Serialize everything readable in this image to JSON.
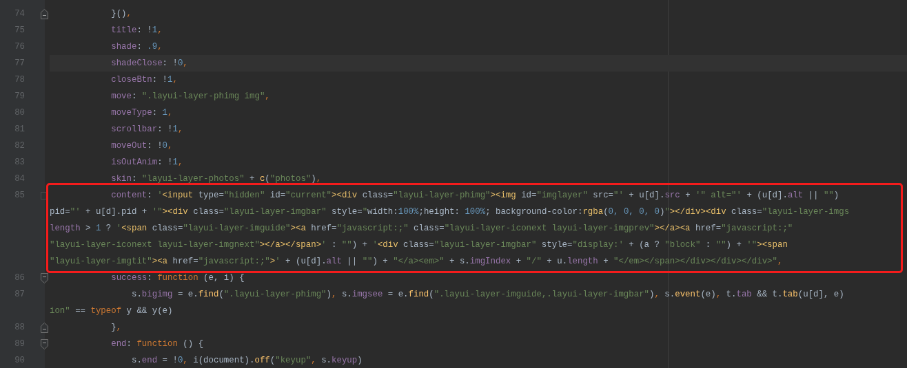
{
  "rows": [
    {
      "number": "74",
      "kind": "fold_end",
      "current": false,
      "tokens": [
        {
          "text": "            }()",
          "kind": "plain"
        },
        {
          "text": ",",
          "kind": "keyword"
        }
      ]
    },
    {
      "number": "75",
      "kind": "line",
      "current": false,
      "tokens": [
        {
          "text": "            title",
          "kind": "prop"
        },
        {
          "text": ": !",
          "kind": "plain"
        },
        {
          "text": "1",
          "kind": "num"
        },
        {
          "text": ",",
          "kind": "keyword"
        }
      ]
    },
    {
      "number": "76",
      "kind": "line",
      "current": false,
      "tokens": [
        {
          "text": "            shade",
          "kind": "prop"
        },
        {
          "text": ": ",
          "kind": "plain"
        },
        {
          "text": ".9",
          "kind": "num"
        },
        {
          "text": ",",
          "kind": "keyword"
        }
      ]
    },
    {
      "number": "77",
      "kind": "line",
      "current": true,
      "tokens": [
        {
          "text": "            shadeClose",
          "kind": "prop"
        },
        {
          "text": ": !",
          "kind": "plain"
        },
        {
          "text": "0",
          "kind": "num"
        },
        {
          "text": ",",
          "kind": "keyword"
        }
      ]
    },
    {
      "number": "78",
      "kind": "line",
      "current": false,
      "tokens": [
        {
          "text": "            closeBtn",
          "kind": "prop"
        },
        {
          "text": ": !",
          "kind": "plain"
        },
        {
          "text": "1",
          "kind": "num"
        },
        {
          "text": ",",
          "kind": "keyword"
        }
      ]
    },
    {
      "number": "79",
      "kind": "line",
      "current": false,
      "tokens": [
        {
          "text": "            move",
          "kind": "prop"
        },
        {
          "text": ": ",
          "kind": "plain"
        },
        {
          "text": "\".layui-layer-phimg img\"",
          "kind": "str"
        },
        {
          "text": ",",
          "kind": "keyword"
        }
      ]
    },
    {
      "number": "80",
      "kind": "line",
      "current": false,
      "tokens": [
        {
          "text": "            moveType",
          "kind": "prop"
        },
        {
          "text": ": ",
          "kind": "plain"
        },
        {
          "text": "1",
          "kind": "num"
        },
        {
          "text": ",",
          "kind": "keyword"
        }
      ]
    },
    {
      "number": "81",
      "kind": "line",
      "current": false,
      "tokens": [
        {
          "text": "            scrollbar",
          "kind": "prop"
        },
        {
          "text": ": !",
          "kind": "plain"
        },
        {
          "text": "1",
          "kind": "num"
        },
        {
          "text": ",",
          "kind": "keyword"
        }
      ]
    },
    {
      "number": "82",
      "kind": "line",
      "current": false,
      "tokens": [
        {
          "text": "            moveOut",
          "kind": "prop"
        },
        {
          "text": ": !",
          "kind": "plain"
        },
        {
          "text": "0",
          "kind": "num"
        },
        {
          "text": ",",
          "kind": "keyword"
        }
      ]
    },
    {
      "number": "83",
      "kind": "line",
      "current": false,
      "tokens": [
        {
          "text": "            isOutAnim",
          "kind": "prop"
        },
        {
          "text": ": !",
          "kind": "plain"
        },
        {
          "text": "1",
          "kind": "num"
        },
        {
          "text": ",",
          "kind": "keyword"
        }
      ]
    },
    {
      "number": "84",
      "kind": "line",
      "current": false,
      "tokens": [
        {
          "text": "            skin",
          "kind": "prop"
        },
        {
          "text": ": ",
          "kind": "plain"
        },
        {
          "text": "\"layui-layer-photos\"",
          "kind": "str"
        },
        {
          "text": " + ",
          "kind": "plain"
        },
        {
          "text": "c",
          "kind": "fn"
        },
        {
          "text": "(",
          "kind": "plain"
        },
        {
          "text": "\"photos\"",
          "kind": "str"
        },
        {
          "text": ")",
          "kind": "plain"
        },
        {
          "text": ",",
          "kind": "keyword"
        }
      ]
    },
    {
      "number": "85",
      "kind": "fold_mark",
      "current": false,
      "tokens": [
        {
          "text": "            content",
          "kind": "prop"
        },
        {
          "text": ": ",
          "kind": "plain"
        },
        {
          "text": "'",
          "kind": "str"
        },
        {
          "text": "<input",
          "kind": "tag"
        },
        {
          "text": " type=",
          "kind": "plain"
        },
        {
          "text": "\"hidden\"",
          "kind": "str"
        },
        {
          "text": " id=",
          "kind": "plain"
        },
        {
          "text": "\"current\"",
          "kind": "str"
        },
        {
          "text": "><div",
          "kind": "tag"
        },
        {
          "text": " class=",
          "kind": "plain"
        },
        {
          "text": "\"layui-layer-phimg\"",
          "kind": "str"
        },
        {
          "text": "><img",
          "kind": "tag"
        },
        {
          "text": " id=",
          "kind": "plain"
        },
        {
          "text": "\"imglayer\"",
          "kind": "str"
        },
        {
          "text": " src=",
          "kind": "plain"
        },
        {
          "text": "\"'",
          "kind": "str"
        },
        {
          "text": " + u[d].",
          "kind": "plain"
        },
        {
          "text": "src",
          "kind": "prop"
        },
        {
          "text": " + ",
          "kind": "plain"
        },
        {
          "text": "'\" alt=\"'",
          "kind": "str"
        },
        {
          "text": " + (u[d].",
          "kind": "plain"
        },
        {
          "text": "alt",
          "kind": "prop"
        },
        {
          "text": " || ",
          "kind": "plain"
        },
        {
          "text": "\"\"",
          "kind": "str"
        },
        {
          "text": ")",
          "kind": "plain"
        }
      ]
    },
    {
      "kind": "wrap",
      "current": false,
      "tokens": [
        {
          "text": "pid=",
          "kind": "plain"
        },
        {
          "text": "\"'",
          "kind": "str"
        },
        {
          "text": " + u[d].pid + ",
          "kind": "plain"
        },
        {
          "text": "'\"",
          "kind": "str"
        },
        {
          "text": "><div",
          "kind": "tag"
        },
        {
          "text": " class=",
          "kind": "plain"
        },
        {
          "text": "\"layui-layer-imgbar\"",
          "kind": "str"
        },
        {
          "text": " style=",
          "kind": "plain"
        },
        {
          "text": "\"",
          "kind": "str"
        },
        {
          "text": "width:",
          "kind": "plain"
        },
        {
          "text": "100%",
          "kind": "num"
        },
        {
          "text": ";height: ",
          "kind": "plain"
        },
        {
          "text": "100%",
          "kind": "num"
        },
        {
          "text": "; background-color:",
          "kind": "plain"
        },
        {
          "text": "rgba",
          "kind": "tag"
        },
        {
          "text": "(",
          "kind": "plain"
        },
        {
          "text": "0, 0, 0, 0",
          "kind": "num"
        },
        {
          "text": ")",
          "kind": "plain"
        },
        {
          "text": "\"",
          "kind": "str"
        },
        {
          "text": "></div><div",
          "kind": "tag"
        },
        {
          "text": " class=",
          "kind": "plain"
        },
        {
          "text": "\"layui-layer-imgs",
          "kind": "str"
        }
      ]
    },
    {
      "kind": "wrap",
      "current": false,
      "tokens": [
        {
          "text": "length",
          "kind": "prop"
        },
        {
          "text": " > ",
          "kind": "plain"
        },
        {
          "text": "1",
          "kind": "num"
        },
        {
          "text": " ? ",
          "kind": "plain"
        },
        {
          "text": "'",
          "kind": "str"
        },
        {
          "text": "<span",
          "kind": "tag"
        },
        {
          "text": " class=",
          "kind": "plain"
        },
        {
          "text": "\"layui-layer-imguide\"",
          "kind": "str"
        },
        {
          "text": "><a",
          "kind": "tag"
        },
        {
          "text": " href=",
          "kind": "plain"
        },
        {
          "text": "\"javascript:;\"",
          "kind": "str"
        },
        {
          "text": " class=",
          "kind": "plain"
        },
        {
          "text": "\"layui-layer-iconext layui-layer-imgprev\"",
          "kind": "str"
        },
        {
          "text": "></a><a",
          "kind": "tag"
        },
        {
          "text": " href=",
          "kind": "plain"
        },
        {
          "text": "\"javascript:;\"",
          "kind": "str"
        }
      ]
    },
    {
      "kind": "wrap",
      "current": false,
      "tokens": [
        {
          "text": "\"layui-layer-iconext layui-layer-imgnext\"",
          "kind": "str"
        },
        {
          "text": "></a></span>",
          "kind": "tag"
        },
        {
          "text": "'",
          "kind": "str"
        },
        {
          "text": " : ",
          "kind": "plain"
        },
        {
          "text": "\"\"",
          "kind": "str"
        },
        {
          "text": ") + ",
          "kind": "plain"
        },
        {
          "text": "'",
          "kind": "str"
        },
        {
          "text": "<div",
          "kind": "tag"
        },
        {
          "text": " class=",
          "kind": "plain"
        },
        {
          "text": "\"layui-layer-imgbar\"",
          "kind": "str"
        },
        {
          "text": " style=",
          "kind": "plain"
        },
        {
          "text": "\"display:'",
          "kind": "str"
        },
        {
          "text": " + (a ? ",
          "kind": "plain"
        },
        {
          "text": "\"block\"",
          "kind": "str"
        },
        {
          "text": " : ",
          "kind": "plain"
        },
        {
          "text": "\"\"",
          "kind": "str"
        },
        {
          "text": ") + ",
          "kind": "plain"
        },
        {
          "text": "'\"",
          "kind": "str"
        },
        {
          "text": "><span",
          "kind": "tag"
        }
      ]
    },
    {
      "kind": "wrap",
      "current": false,
      "tokens": [
        {
          "text": "\"layui-layer-imgtit\"",
          "kind": "str"
        },
        {
          "text": "><a",
          "kind": "tag"
        },
        {
          "text": " href=",
          "kind": "plain"
        },
        {
          "text": "\"javascript:;\"",
          "kind": "str"
        },
        {
          "text": ">",
          "kind": "tag"
        },
        {
          "text": "'",
          "kind": "str"
        },
        {
          "text": " + (u[d].",
          "kind": "plain"
        },
        {
          "text": "alt",
          "kind": "prop"
        },
        {
          "text": " || ",
          "kind": "plain"
        },
        {
          "text": "\"\"",
          "kind": "str"
        },
        {
          "text": ") + ",
          "kind": "plain"
        },
        {
          "text": "\"</a><em>\"",
          "kind": "str"
        },
        {
          "text": " + s.",
          "kind": "plain"
        },
        {
          "text": "imgIndex",
          "kind": "prop"
        },
        {
          "text": " + ",
          "kind": "plain"
        },
        {
          "text": "\"/\"",
          "kind": "str"
        },
        {
          "text": " + u.",
          "kind": "plain"
        },
        {
          "text": "length",
          "kind": "prop"
        },
        {
          "text": " + ",
          "kind": "plain"
        },
        {
          "text": "\"</em></span></div></div></div>\"",
          "kind": "str"
        },
        {
          "text": ",",
          "kind": "keyword"
        }
      ]
    },
    {
      "number": "86",
      "kind": "fold_start",
      "current": false,
      "tokens": [
        {
          "text": "            success",
          "kind": "prop"
        },
        {
          "text": ": ",
          "kind": "plain"
        },
        {
          "text": "function",
          "kind": "keyword"
        },
        {
          "text": " (e, i) {",
          "kind": "plain"
        }
      ]
    },
    {
      "number": "87",
      "kind": "line",
      "current": false,
      "tokens": [
        {
          "text": "                s.",
          "kind": "plain"
        },
        {
          "text": "bigimg",
          "kind": "prop"
        },
        {
          "text": " = e.",
          "kind": "plain"
        },
        {
          "text": "find",
          "kind": "fn"
        },
        {
          "text": "(",
          "kind": "plain"
        },
        {
          "text": "\".layui-layer-phimg\"",
          "kind": "str"
        },
        {
          "text": ")",
          "kind": "plain"
        },
        {
          "text": ", ",
          "kind": "keyword"
        },
        {
          "text": "s.",
          "kind": "plain"
        },
        {
          "text": "imgsee",
          "kind": "prop"
        },
        {
          "text": " = e.",
          "kind": "plain"
        },
        {
          "text": "find",
          "kind": "fn"
        },
        {
          "text": "(",
          "kind": "plain"
        },
        {
          "text": "\".layui-layer-imguide,.layui-layer-imgbar\"",
          "kind": "str"
        },
        {
          "text": ")",
          "kind": "plain"
        },
        {
          "text": ", ",
          "kind": "keyword"
        },
        {
          "text": "s.",
          "kind": "plain"
        },
        {
          "text": "event",
          "kind": "fn"
        },
        {
          "text": "(e)",
          "kind": "plain"
        },
        {
          "text": ", ",
          "kind": "keyword"
        },
        {
          "text": "t.",
          "kind": "plain"
        },
        {
          "text": "tab",
          "kind": "prop"
        },
        {
          "text": " && t.",
          "kind": "plain"
        },
        {
          "text": "tab",
          "kind": "fn"
        },
        {
          "text": "(u[d], e)",
          "kind": "plain"
        }
      ]
    },
    {
      "kind": "wrap",
      "current": false,
      "tokens": [
        {
          "text": "ion\"",
          "kind": "str"
        },
        {
          "text": " == ",
          "kind": "plain"
        },
        {
          "text": "typeof",
          "kind": "keyword"
        },
        {
          "text": " y && y(e)",
          "kind": "plain"
        }
      ]
    },
    {
      "number": "88",
      "kind": "fold_end",
      "current": false,
      "tokens": [
        {
          "text": "            }",
          "kind": "plain"
        },
        {
          "text": ",",
          "kind": "keyword"
        }
      ]
    },
    {
      "number": "89",
      "kind": "fold_start",
      "current": false,
      "tokens": [
        {
          "text": "            end",
          "kind": "prop"
        },
        {
          "text": ": ",
          "kind": "plain"
        },
        {
          "text": "function",
          "kind": "keyword"
        },
        {
          "text": " () {",
          "kind": "plain"
        }
      ]
    },
    {
      "number": "90",
      "kind": "line",
      "current": false,
      "tokens": [
        {
          "text": "                s.",
          "kind": "plain"
        },
        {
          "text": "end",
          "kind": "prop"
        },
        {
          "text": " = !",
          "kind": "plain"
        },
        {
          "text": "0",
          "kind": "num"
        },
        {
          "text": ", ",
          "kind": "keyword"
        },
        {
          "text": "i(document).",
          "kind": "plain"
        },
        {
          "text": "off",
          "kind": "fn"
        },
        {
          "text": "(",
          "kind": "plain"
        },
        {
          "text": "\"keyup\"",
          "kind": "str"
        },
        {
          "text": ", ",
          "kind": "keyword"
        },
        {
          "text": "s.",
          "kind": "plain"
        },
        {
          "text": "keyup",
          "kind": "prop"
        },
        {
          "text": ")",
          "kind": "plain"
        }
      ]
    }
  ]
}
